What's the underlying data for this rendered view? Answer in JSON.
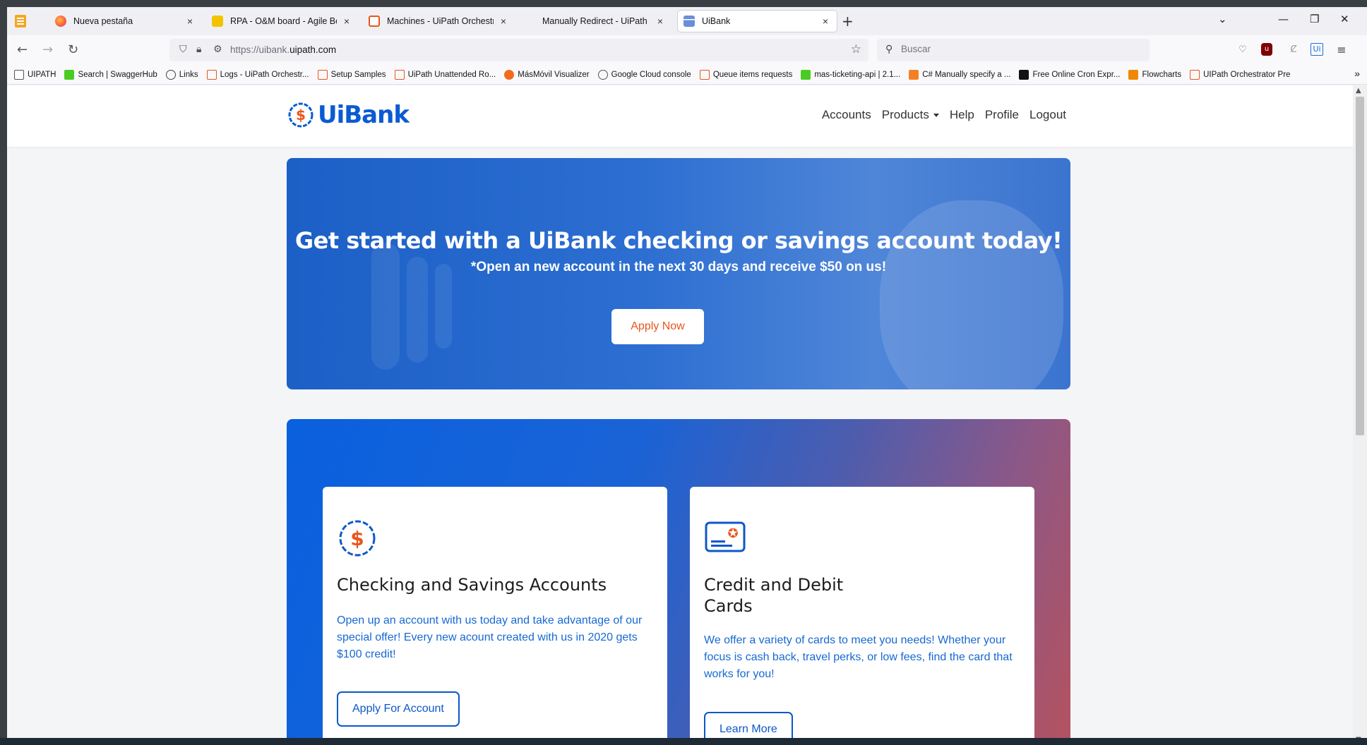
{
  "browser": {
    "tabs": [
      {
        "title": "Nueva pestaña",
        "active": false
      },
      {
        "title": "RPA - O&M board - Agile Boards",
        "active": false
      },
      {
        "title": "Machines - UiPath Orchestrator",
        "active": false
      },
      {
        "title": "Manually Redirect - UiPath Identity",
        "active": false
      },
      {
        "title": "UiBank",
        "active": true
      }
    ],
    "close_glyph": "×",
    "new_tab_glyph": "+",
    "url_scheme": "https://uibank.",
    "url_host": "uipath.com",
    "search_placeholder": "Buscar",
    "bookmarks": [
      {
        "label": "UIPATH",
        "icon": "folder-icon"
      },
      {
        "label": "Search | SwaggerHub",
        "icon": "swagger-icon"
      },
      {
        "label": "Links",
        "icon": "globe-icon"
      },
      {
        "label": "Logs - UiPath Orchestr...",
        "icon": "uipath-icon"
      },
      {
        "label": "Setup Samples",
        "icon": "uipath-icon"
      },
      {
        "label": "UiPath Unattended Ro...",
        "icon": "uipath-icon"
      },
      {
        "label": "MásMóvil Visualizer",
        "icon": "gear-icon"
      },
      {
        "label": "Google Cloud console",
        "icon": "gear-icon"
      },
      {
        "label": "Queue items requests",
        "icon": "uipath-icon"
      },
      {
        "label": "mas-ticketing-api | 2.1...",
        "icon": "swagger-icon"
      },
      {
        "label": "C# Manually specify a ...",
        "icon": "stack-icon"
      },
      {
        "label": "Free Online Cron Expr...",
        "icon": "ff-icon"
      },
      {
        "label": "Flowcharts",
        "icon": "flowchart-icon"
      },
      {
        "label": "UIPath Orchestrator Pre",
        "icon": "uipath-icon"
      }
    ]
  },
  "site": {
    "brand": "UiBank",
    "nav": [
      "Accounts",
      "Products",
      "Help",
      "Profile",
      "Logout"
    ],
    "hero": {
      "title": "Get started with a UiBank checking or savings account today!",
      "subtitle": "*Open an new account in the next 30 days and receive $50 on us!",
      "button": "Apply Now"
    },
    "cards": [
      {
        "title": "Checking and Savings Accounts",
        "text": "Open up an account with us today and take advantage of our special offer! Every new acount created with us in 2020 gets $100 credit!",
        "button": "Apply For Account"
      },
      {
        "title": "Credit and Debit Cards",
        "text": "We offer a variety of cards to meet you needs! Whether your focus is cash back, travel perks, or low fees, find the card that works for you!",
        "button": "Learn More"
      }
    ]
  },
  "colors": {
    "brand_blue": "#0a5bd3",
    "accent_orange": "#e8561d"
  }
}
